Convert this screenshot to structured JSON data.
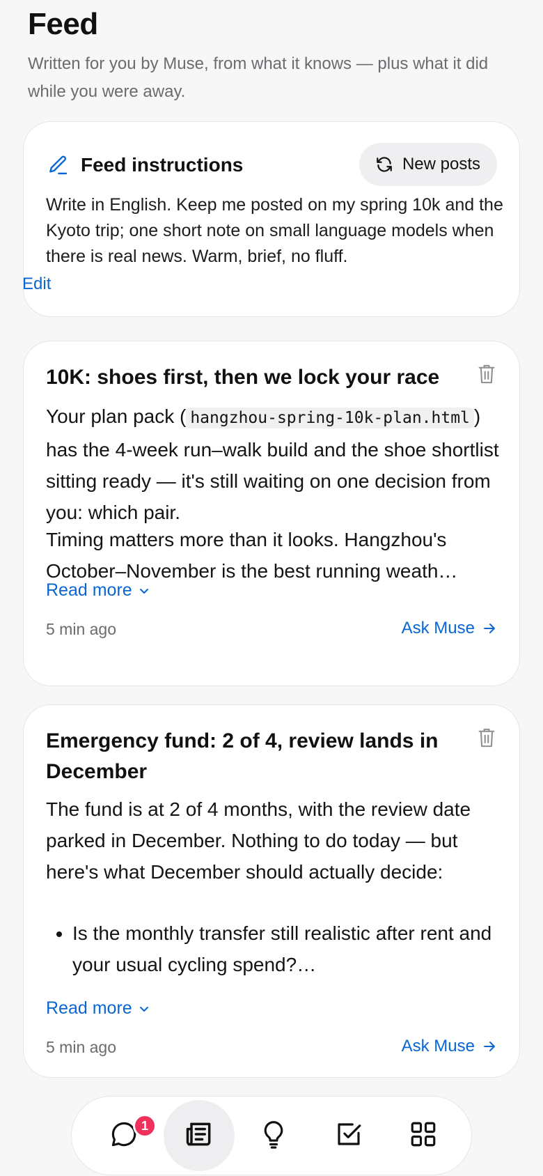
{
  "header": {
    "title": "Feed",
    "subtitle": "Written for you by Muse, from what it knows — plus what it did while you were away."
  },
  "instructions": {
    "title": "Feed instructions",
    "new_posts_label": "New posts",
    "body": "Write in English. Keep me posted on my spring 10k and the Kyoto trip; one short note on small language models when there is real news. Warm, brief, no fluff.",
    "edit_label": "Edit"
  },
  "posts": [
    {
      "title": "10K: shoes first, then we lock your race",
      "p1_before": "Your plan pack (",
      "p1_code": "hangzhou-spring-10k-plan.html",
      "p1_after": ") has the 4-week run–walk build and the shoe shortlist sitting ready — it's still waiting on one decision from you: which pair.",
      "p2": "Timing matters more than it looks. Hangzhou's October–November is the best running weath…",
      "read_more": "Read more",
      "time": "5 min ago",
      "ask_label": "Ask Muse"
    },
    {
      "title": "Emergency fund: 2 of 4, review lands in December",
      "p1": "The fund is at 2 of 4 months, with the review date parked in December. Nothing to do today — but here's what December should actually decide:",
      "bullet1": "Is the monthly transfer still realistic after rent and your usual cycling spend?…",
      "read_more": "Read more",
      "time": "5 min ago",
      "ask_label": "Ask Muse"
    }
  ],
  "nav": {
    "chat_badge": "1",
    "items": [
      "chat-icon",
      "feed-icon",
      "lightbulb-icon",
      "tasks-icon",
      "apps-icon"
    ],
    "active": "feed-icon"
  },
  "colors": {
    "accent": "#0a66d2",
    "badge": "#f0325a",
    "background": "#f7f7f8"
  }
}
